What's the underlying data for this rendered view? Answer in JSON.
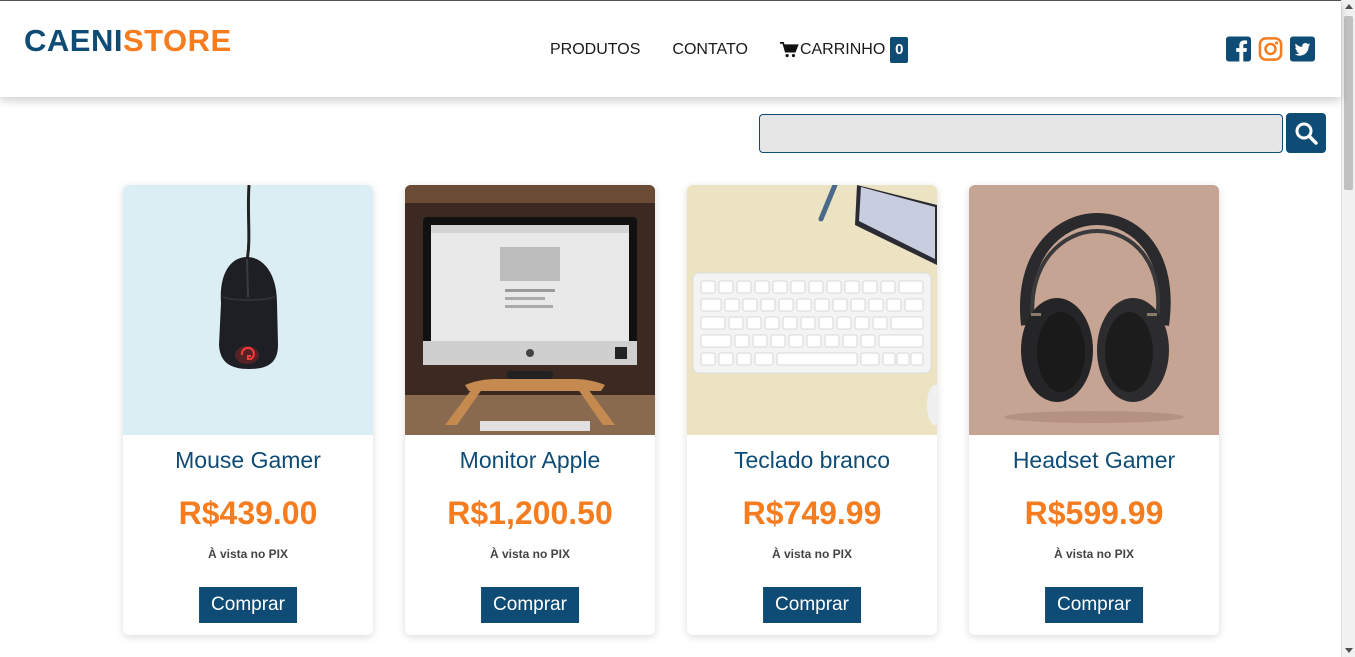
{
  "header": {
    "logo_part1": "CAENI",
    "logo_part2": "STORE",
    "nav": {
      "produtos": "PRODUTOS",
      "contato": "CONTATO",
      "carrinho": "CARRINHO",
      "cart_count": "0"
    },
    "social": [
      "facebook-icon",
      "instagram-icon",
      "twitter-icon"
    ]
  },
  "search": {
    "value": "",
    "placeholder": ""
  },
  "products": [
    {
      "name": "Mouse Gamer",
      "price": "R$439.00",
      "payment_note": "À vista no PIX",
      "buy_label": "Comprar"
    },
    {
      "name": "Monitor Apple",
      "price": "R$1,200.50",
      "payment_note": "À vista no PIX",
      "buy_label": "Comprar"
    },
    {
      "name": "Teclado branco",
      "price": "R$749.99",
      "payment_note": "À vista no PIX",
      "buy_label": "Comprar"
    },
    {
      "name": "Headset Gamer",
      "price": "R$599.99",
      "payment_note": "À vista no PIX",
      "buy_label": "Comprar"
    }
  ],
  "colors": {
    "primary": "#0f4c75",
    "accent": "#f57c1f"
  }
}
